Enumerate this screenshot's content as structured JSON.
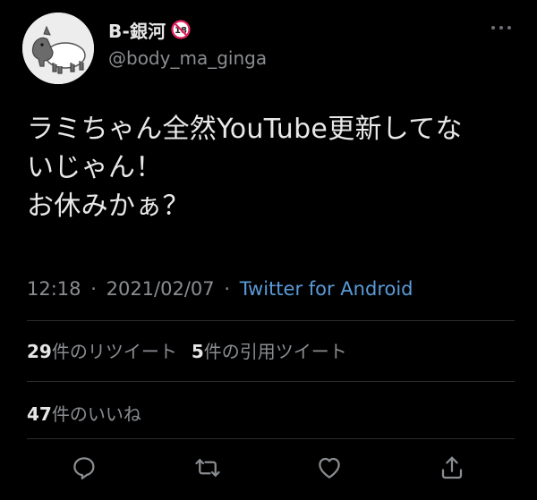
{
  "user": {
    "display_name": "B-銀河",
    "handle": "@body_ma_ginga",
    "avatar_icon": "tapir-avatar-icon",
    "badge_icon": "no-under-18-icon",
    "badge_color": "#e0245e"
  },
  "tweet": {
    "lines": [
      "ラミちゃん全然YouTube更新してな",
      "いじゃん！",
      "お休みかぁ？"
    ]
  },
  "meta": {
    "time": "12:18",
    "separator": "·",
    "date": "2021/02/07",
    "source": "Twitter for Android"
  },
  "stats": {
    "retweets_count": "29",
    "retweets_label": "件のリツイート",
    "quotes_count": "5",
    "quotes_label": "件の引用ツイート",
    "likes_count": "47",
    "likes_label": "件のいいね"
  },
  "actions": [
    "reply-icon",
    "retweet-icon",
    "like-icon",
    "share-icon"
  ],
  "colors": {
    "background": "#000000",
    "text": "#e8e8e8",
    "secondary": "#8a8d91",
    "link": "#5a9bd8",
    "divider": "#2a2c2f"
  }
}
